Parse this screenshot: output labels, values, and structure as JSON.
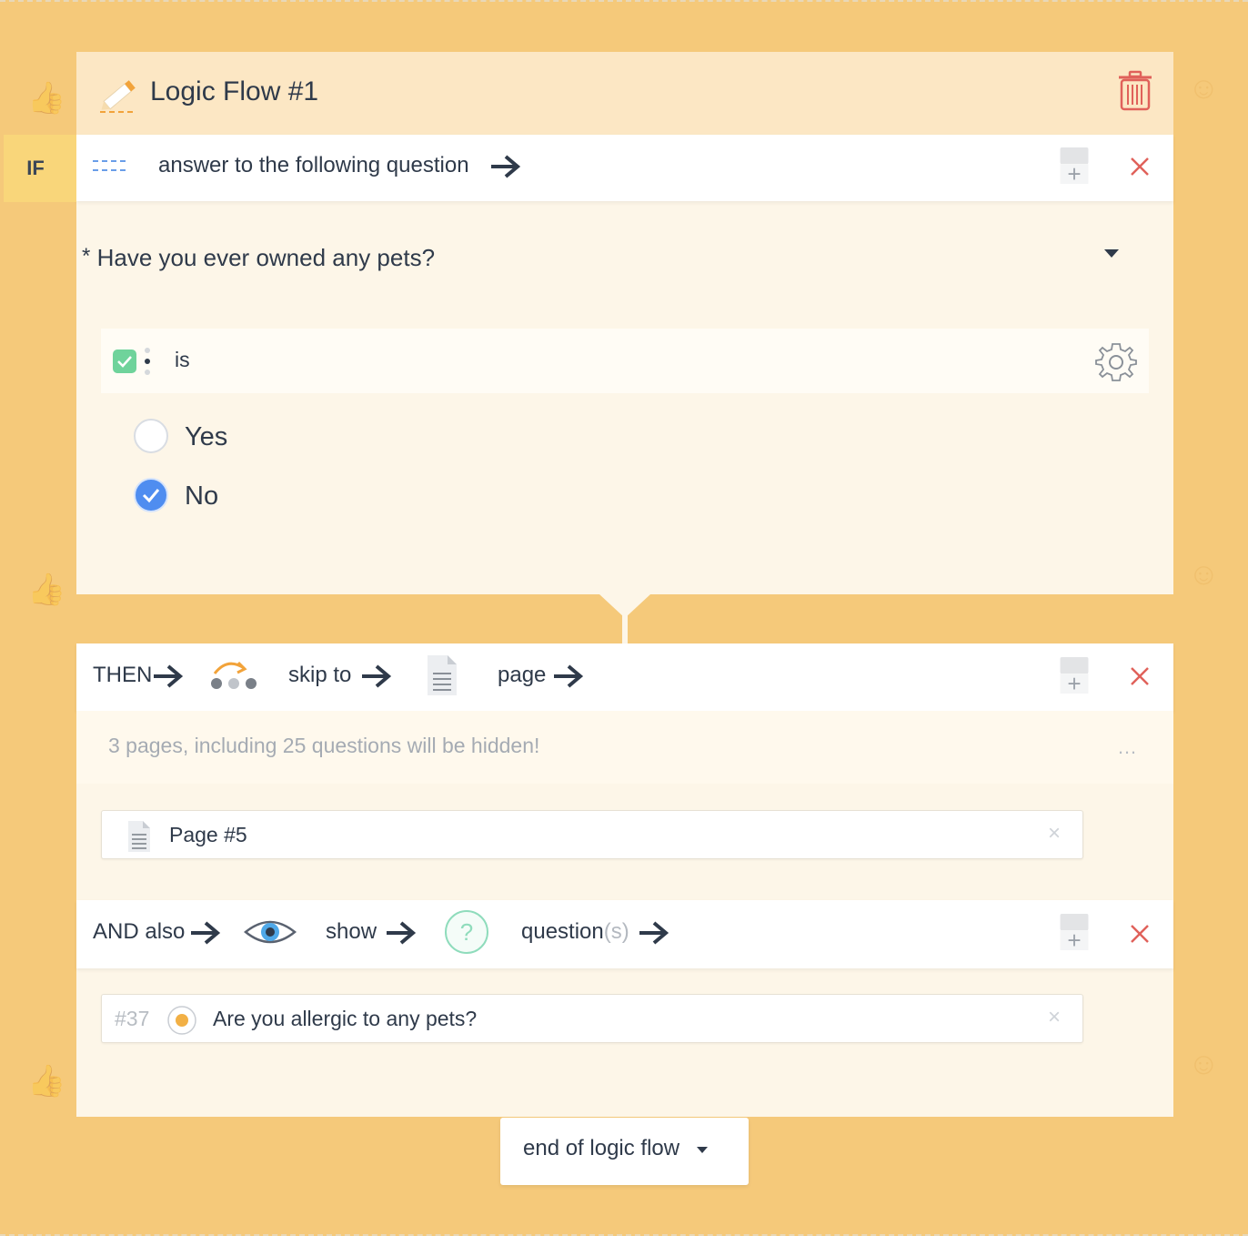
{
  "flow": {
    "title": "Logic Flow #1"
  },
  "if_block": {
    "tag": "IF",
    "condition_label": "answer to the following question",
    "question": {
      "required_mark": "*",
      "text": "Have you ever owned any pets?"
    },
    "operator": "is",
    "options": [
      {
        "label": "Yes",
        "selected": false
      },
      {
        "label": "No",
        "selected": true
      }
    ]
  },
  "then_block": {
    "tag": "THEN",
    "action": "skip to",
    "target": "page",
    "note": "3 pages, including 25 questions will be hidden!",
    "more": "…",
    "selected_page": "Page #5"
  },
  "and_block": {
    "tag": "AND also",
    "action": "show",
    "target": "question",
    "target_suffix": "(s)",
    "selected_question": {
      "number": "#37",
      "text": "Are you allergic to any pets?"
    }
  },
  "footer": {
    "end_label": "end of logic flow"
  },
  "icons": {
    "plus": "+",
    "close": "×",
    "help": "?"
  },
  "colors": {
    "background": "#f5c97a",
    "header": "#fce7c4",
    "card": "#fdf6e8",
    "if_tag": "#f9d67a",
    "accent_blue": "#4f8df0",
    "close_red": "#e0615a",
    "check_green": "#6fd39b"
  }
}
